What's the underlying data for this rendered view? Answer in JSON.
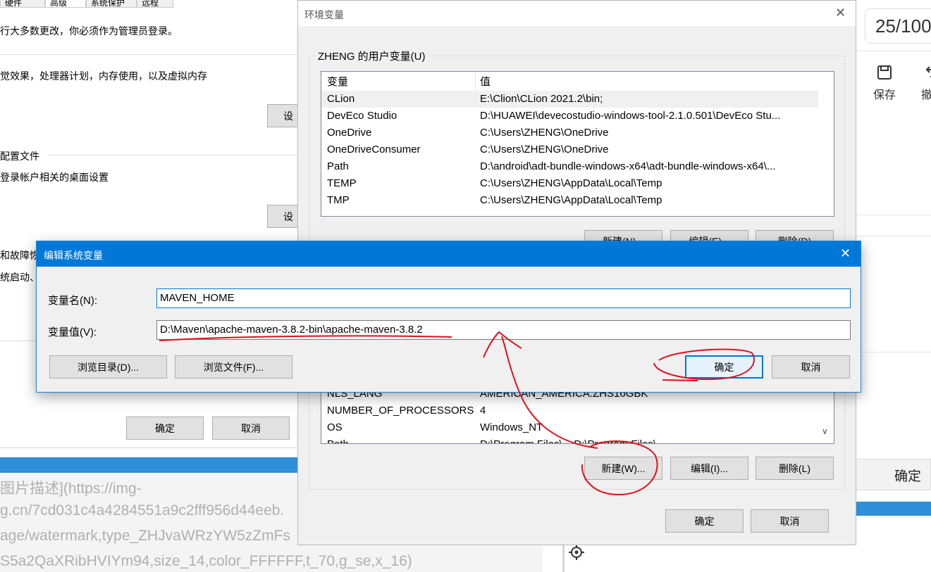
{
  "sys_props": {
    "tabs": [
      "硬件",
      "高级",
      "系统保护",
      "远程"
    ],
    "admin_note": "行大多数更改，你必须作为管理员登录。",
    "performance_desc": "觉效果，处理器计划，内存使用，以及虚拟内存",
    "settings_label": "设",
    "profiles_title": "配置文件",
    "profiles_desc": "登录帐户相关的桌面设置",
    "startup_title": "和故障恢",
    "startup_desc": "统启动、",
    "ok_label": "确定",
    "cancel_label": "取消"
  },
  "blog": {
    "lines": [
      "图片描述](https://img-",
      "g.cn/7cd031c4a4284551a9c2fff956d44eeb.",
      "age/watermark,type_ZHJvaWRzYW5zZmFs",
      "S5a2QaXRibHVIYm94,size_14,color_FFFFFF,t_70,g_se,x_16)"
    ]
  },
  "editor": {
    "page_counter": "25/100",
    "save_label": "保存",
    "undo_label": "撤",
    "confirm_label": "确定",
    "save_icon": "save-icon",
    "undo_icon": "undo-icon",
    "target_icon": "crosshair-icon"
  },
  "env_dialog": {
    "title": "环境变量",
    "user_group_title": "ZHENG 的用户变量(U)",
    "headers": {
      "name": "变量",
      "value": "值"
    },
    "user_vars": [
      {
        "name": "CLion",
        "value": "E:\\Clion\\CLion 2021.2\\bin;"
      },
      {
        "name": "DevEco Studio",
        "value": "D:\\HUAWEI\\devecostudio-windows-tool-2.1.0.501\\DevEco Stu..."
      },
      {
        "name": "OneDrive",
        "value": "C:\\Users\\ZHENG\\OneDrive"
      },
      {
        "name": "OneDriveConsumer",
        "value": "C:\\Users\\ZHENG\\OneDrive"
      },
      {
        "name": "Path",
        "value": "D:\\android\\adt-bundle-windows-x64\\adt-bundle-windows-x64\\..."
      },
      {
        "name": "TEMP",
        "value": "C:\\Users\\ZHENG\\AppData\\Local\\Temp"
      },
      {
        "name": "TMP",
        "value": "C:\\Users\\ZHENG\\AppData\\Local\\Temp"
      }
    ],
    "user_buttons": {
      "new": "新建(N)...",
      "edit": "编辑(E)...",
      "delete": "删除(D)"
    },
    "system_vars": [
      {
        "name": "NLS_LANG",
        "value": "AMERICAN_AMERICA.ZHS16GBK"
      },
      {
        "name": "NUMBER_OF_PROCESSORS",
        "value": "4"
      },
      {
        "name": "OS",
        "value": "Windows_NT"
      },
      {
        "name": "Path",
        "value": "D:\\Program Files\\...;D:\\Program Files\\..."
      }
    ],
    "system_buttons": {
      "new": "新建(W)...",
      "edit": "编辑(I)...",
      "delete": "删除(L)"
    },
    "ok_label": "确定",
    "cancel_label": "取消",
    "close_glyph": "✕"
  },
  "edit_dialog": {
    "title": "编辑系统变量",
    "name_label": "变量名(N):",
    "name_value": "MAVEN_HOME",
    "value_label": "变量值(V):",
    "value_value": "D:\\Maven\\apache-maven-3.8.2-bin\\apache-maven-3.8.2",
    "browse_dir": "浏览目录(D)...",
    "browse_file": "浏览文件(F)...",
    "ok_label": "确定",
    "cancel_label": "取消",
    "close_glyph": "✕"
  },
  "colors": {
    "accent": "#0078d7",
    "annotation": "#e0101a"
  }
}
